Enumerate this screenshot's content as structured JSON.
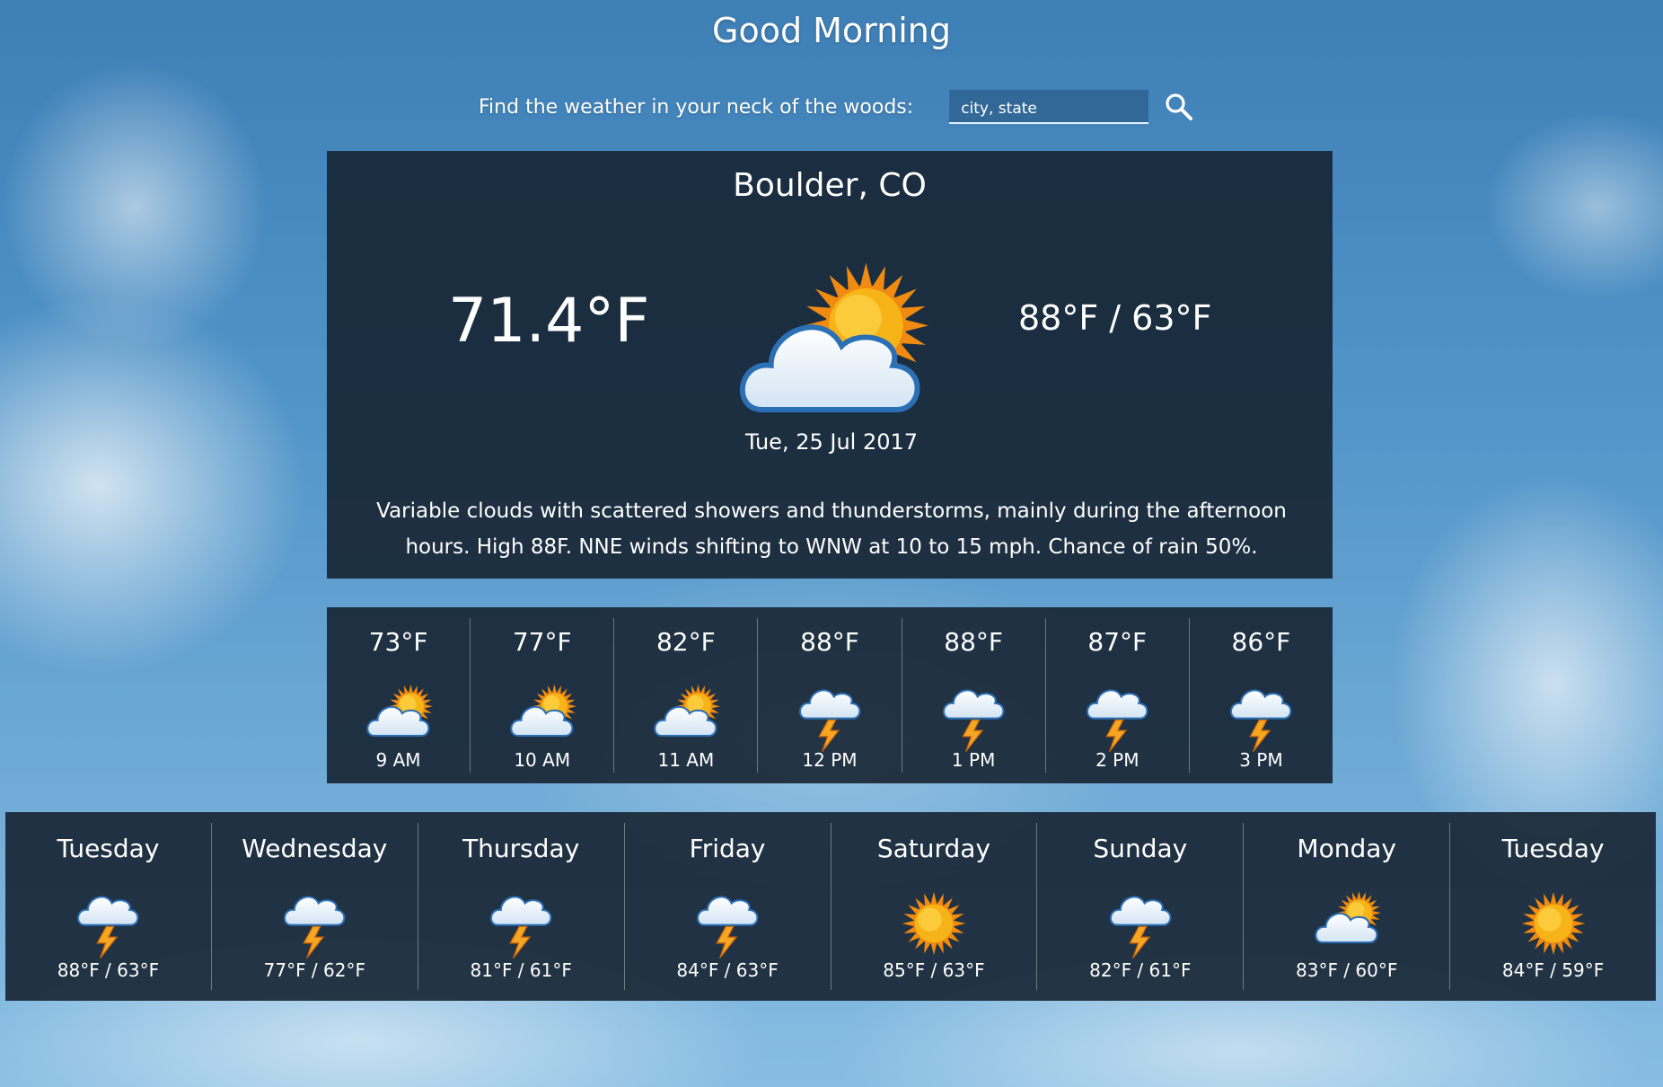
{
  "header": {
    "greeting": "Good Morning",
    "search_prompt": "Find the weather in your neck of the woods:",
    "search_placeholder": "city, state",
    "search_icon": "search-icon"
  },
  "current": {
    "city": "Boulder, CO",
    "temperature": "71.4°F",
    "icon": "partly-cloudy-icon",
    "hi_lo": "88°F / 63°F",
    "date": "Tue, 25 Jul 2017",
    "summary": "Variable clouds with scattered showers and thunderstorms, mainly during the afternoon hours. High 88F. NNE winds shifting to WNW at 10 to 15 mph. Chance of rain 50%."
  },
  "hourly": [
    {
      "temp": "73°F",
      "time": "9 AM",
      "icon": "partly-cloudy-icon"
    },
    {
      "temp": "77°F",
      "time": "10 AM",
      "icon": "partly-cloudy-icon"
    },
    {
      "temp": "82°F",
      "time": "11 AM",
      "icon": "partly-cloudy-icon"
    },
    {
      "temp": "88°F",
      "time": "12 PM",
      "icon": "thunderstorm-icon"
    },
    {
      "temp": "88°F",
      "time": "1 PM",
      "icon": "thunderstorm-icon"
    },
    {
      "temp": "87°F",
      "time": "2 PM",
      "icon": "thunderstorm-icon"
    },
    {
      "temp": "86°F",
      "time": "3 PM",
      "icon": "thunderstorm-icon"
    }
  ],
  "daily": [
    {
      "day": "Tuesday",
      "temps": "88°F / 63°F",
      "icon": "thunderstorm-icon"
    },
    {
      "day": "Wednesday",
      "temps": "77°F / 62°F",
      "icon": "thunderstorm-icon"
    },
    {
      "day": "Thursday",
      "temps": "81°F / 61°F",
      "icon": "thunderstorm-icon"
    },
    {
      "day": "Friday",
      "temps": "84°F / 63°F",
      "icon": "thunderstorm-icon"
    },
    {
      "day": "Saturday",
      "temps": "85°F / 63°F",
      "icon": "sunny-icon"
    },
    {
      "day": "Sunday",
      "temps": "82°F / 61°F",
      "icon": "thunderstorm-icon"
    },
    {
      "day": "Monday",
      "temps": "83°F / 60°F",
      "icon": "partly-cloudy-icon"
    },
    {
      "day": "Tuesday",
      "temps": "84°F / 59°F",
      "icon": "sunny-icon"
    }
  ],
  "colors": {
    "panel_bg": "#162432",
    "sky_top": "#3e7fb6",
    "sky_bottom": "#87bde2",
    "sun": "#f7b418",
    "bolt": "#f5a623"
  }
}
